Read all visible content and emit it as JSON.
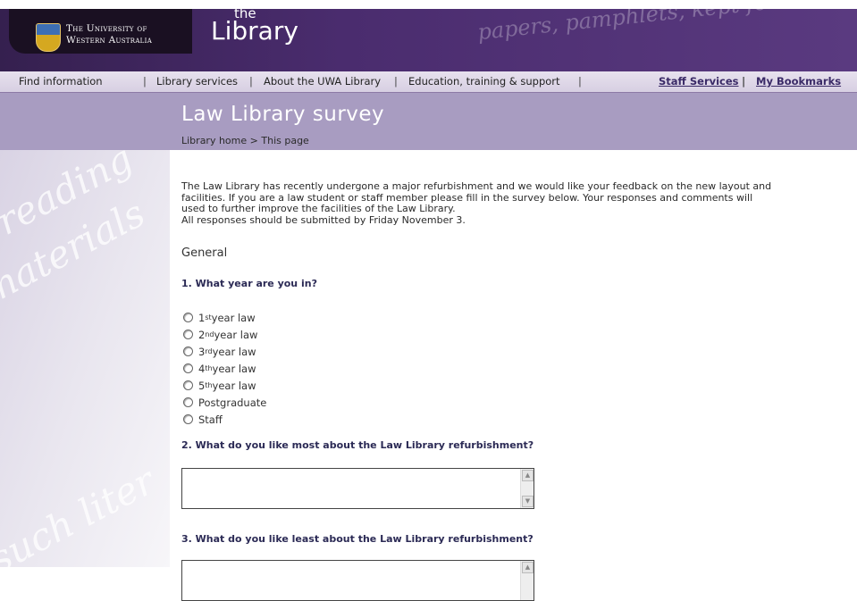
{
  "header": {
    "university_line1": "The University of",
    "university_line2": "Western Australia",
    "library_the": "the",
    "library_name": "Library",
    "watermark_text": "papers, pamphlets, kept for reading"
  },
  "nav": {
    "items": [
      "Find information",
      "Library services",
      "About the UWA Library",
      "Education, training & support"
    ],
    "staff_services": "Staff Services",
    "my_bookmarks": "My Bookmarks",
    "separator": "|"
  },
  "page": {
    "title": "Law Library survey",
    "breadcrumb_home": "Library home",
    "breadcrumb_sep": ">",
    "breadcrumb_current": "This page"
  },
  "intro": {
    "line1": "The Law Library has recently undergone a major refurbishment and we would like your feedback on the new layout and",
    "line2": "facilities. If you are a law student or staff member please fill in the survey below. Your responses and comments will",
    "line3": "used to further improve the facilities of the Law Library.",
    "line4": "All responses should be submitted by Friday November 3."
  },
  "section": "General",
  "questions": {
    "q1": "1. What year are you in?",
    "q2": "2. What do you like most about the Law Library refurbishment?",
    "q3": "3. What do you like least about the Law Library refurbishment?"
  },
  "options": [
    {
      "num": "1",
      "sup": "st",
      "rest": " year law"
    },
    {
      "num": "2",
      "sup": "nd",
      "rest": " year law"
    },
    {
      "num": "3",
      "sup": "rd",
      "rest": " year law"
    },
    {
      "num": "4",
      "sup": "th",
      "rest": " year law"
    },
    {
      "num": "5",
      "sup": "th",
      "rest": " year law"
    },
    {
      "num": "Postgraduate",
      "sup": "",
      "rest": ""
    },
    {
      "num": "Staff",
      "sup": "",
      "rest": ""
    }
  ],
  "left_watermark": [
    "reading",
    "materials",
    "such liter"
  ],
  "colors": {
    "header_purple": "#4a2c6e",
    "title_band": "#a89cc1",
    "question_text": "#2b2a55"
  }
}
